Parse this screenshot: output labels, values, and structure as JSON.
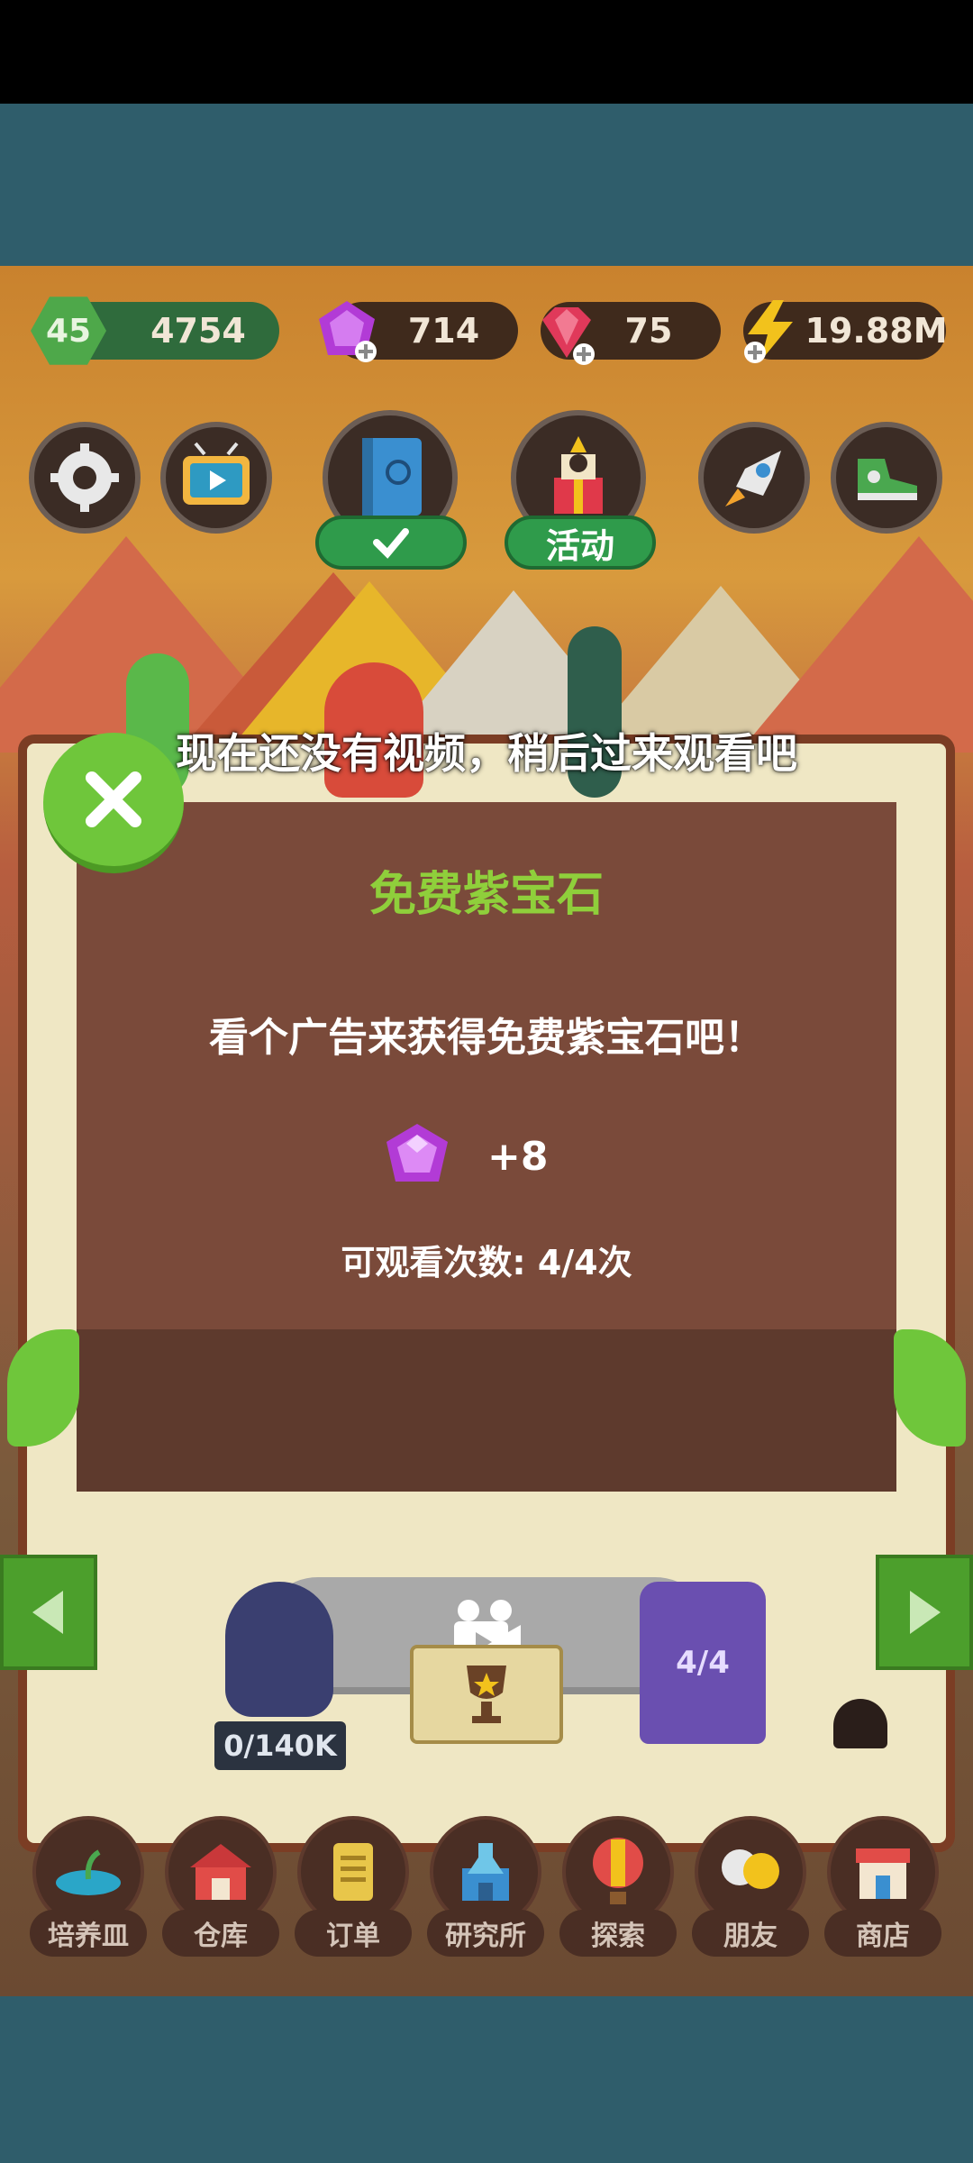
{
  "resources": {
    "level": "45",
    "coins": "4754",
    "purple_gems": "714",
    "red_gems": "75",
    "energy": "19.88M"
  },
  "top_buttons": {
    "event_label": "活动"
  },
  "toast": {
    "text": "现在还没有视频，稍后过来观看吧"
  },
  "dialog": {
    "title": "免费紫宝石",
    "message": "看个广告来获得免费紫宝石吧！",
    "reward_amount": "+8",
    "watch_count": "可观看次数: 4/4次"
  },
  "stage": {
    "left_pedestal": "0/140K",
    "right_statue": "4/4"
  },
  "bottom_nav": [
    {
      "label": "培养皿"
    },
    {
      "label": "仓库"
    },
    {
      "label": "订单"
    },
    {
      "label": "研究所"
    },
    {
      "label": "探索"
    },
    {
      "label": "朋友"
    },
    {
      "label": "商店"
    }
  ],
  "colors": {
    "accent_green": "#8fcf3b",
    "dialog_bg": "#7a4a3a",
    "purple_gem": "#b23bd6",
    "red_gem": "#e0395a"
  }
}
